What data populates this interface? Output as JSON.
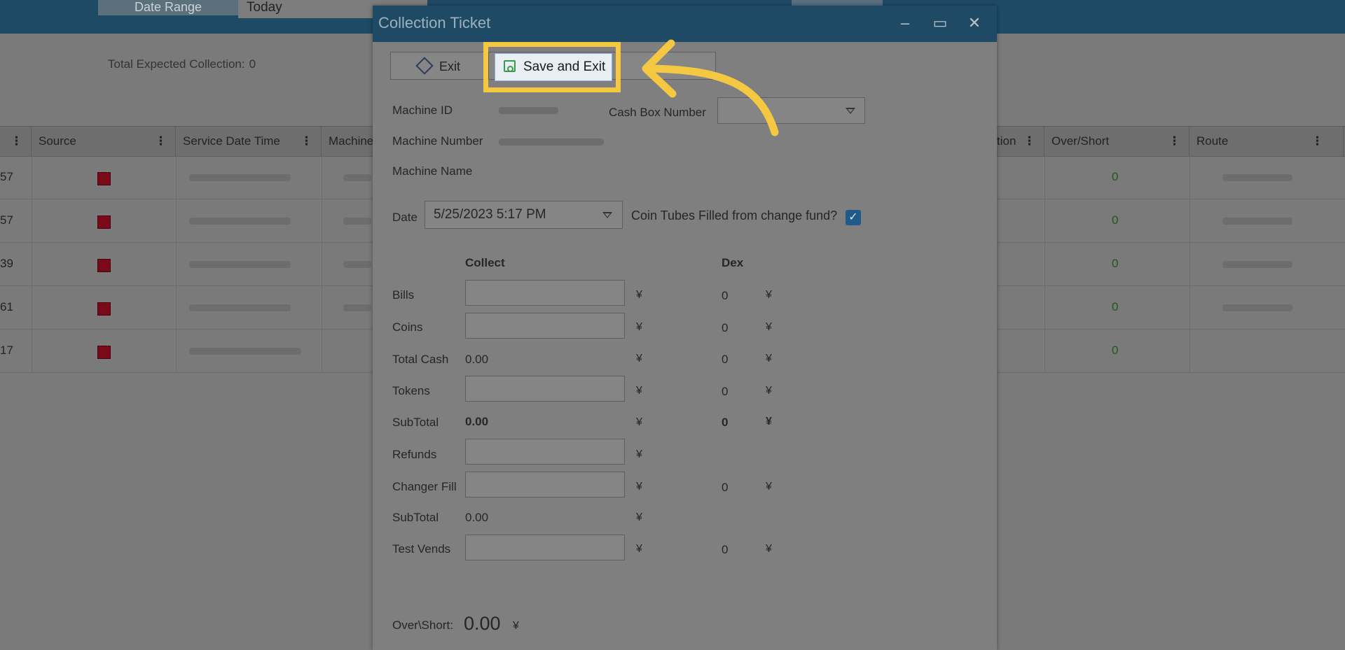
{
  "background": {
    "date_range_label": "Date Range",
    "date_range_value": "Today",
    "total_expected_label": "Total Expected Collection:",
    "total_expected_value": "0",
    "columns": [
      "Source",
      "Service Date Time",
      "Machine",
      "tion",
      "Over/Short",
      "Route"
    ],
    "rows": [
      {
        "id_tail": "57",
        "over_short": "0"
      },
      {
        "id_tail": "57",
        "over_short": "0"
      },
      {
        "id_tail": "39",
        "over_short": "0"
      },
      {
        "id_tail": "61",
        "over_short": "0"
      },
      {
        "id_tail": "17",
        "over_short": "0"
      }
    ]
  },
  "dialog": {
    "title": "Collection Ticket",
    "exit_label": "Exit",
    "save_exit_label": "Save and Exit",
    "machine_id_label": "Machine ID",
    "machine_number_label": "Machine Number",
    "machine_name_label": "Machine Name",
    "cash_box_label": "Cash Box Number",
    "date_label": "Date",
    "date_value": "5/25/2023 5:17 PM",
    "coin_tubes_label": "Coin Tubes Filled from change fund?",
    "coin_tubes_checked": true,
    "collect_header": "Collect",
    "dex_header": "Dex",
    "currency": "¥",
    "rows": [
      {
        "label": "Bills",
        "collect": "",
        "dex": "0"
      },
      {
        "label": "Coins",
        "collect": "",
        "dex": "0"
      },
      {
        "label": "Total Cash",
        "collect": "0.00",
        "dex": "0"
      },
      {
        "label": "Tokens",
        "collect": "",
        "dex": "0"
      },
      {
        "label": "SubTotal",
        "collect": "0.00",
        "dex": "0"
      },
      {
        "label": "Refunds",
        "collect": "",
        "dex": ""
      },
      {
        "label": "Changer Fill",
        "collect": "",
        "dex": "0"
      },
      {
        "label": "SubTotal",
        "collect": "0.00",
        "dex": ""
      },
      {
        "label": "Test Vends",
        "collect": "",
        "dex": "0"
      }
    ],
    "over_short_label": "Over\\Short:",
    "over_short_value": "0.00"
  },
  "colors": {
    "highlight": "#f5c842",
    "titlebar": "#1f4a66",
    "accent_green": "#3b9a4d"
  }
}
